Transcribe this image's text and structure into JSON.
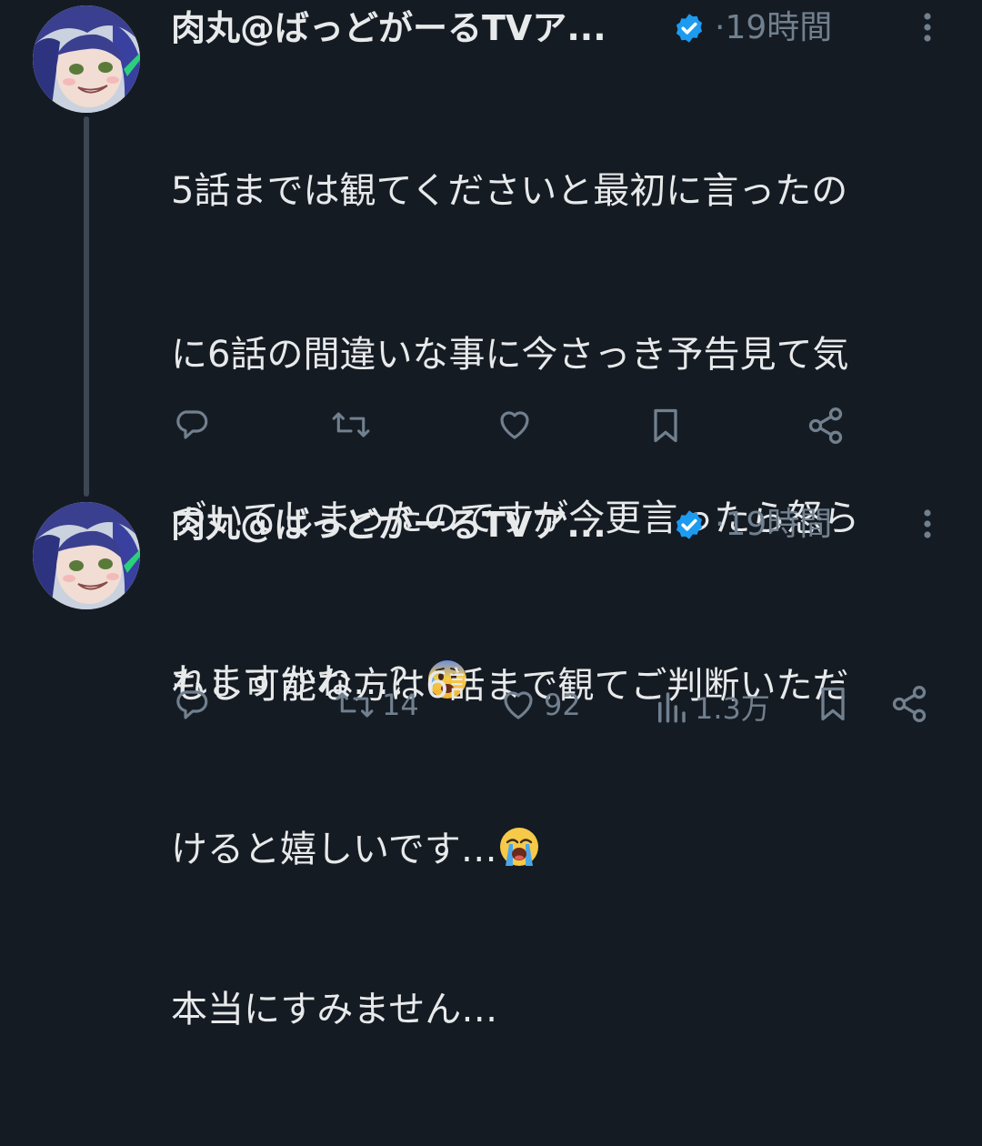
{
  "tweets": [
    {
      "author": "肉丸@ばっどがーるTVア...",
      "time": "·19時間",
      "text_lines": [
        "5話までは観てくださいと最初に言ったの",
        "に6話の間違いな事に今さっき予告見て気",
        "づいてしまったのですが今更言ったら怒ら",
        "れますかね…？",
        "",
        "本当にすみません…"
      ],
      "emoji_after_line4": "anxious-face-with-sweat-emoji"
    },
    {
      "author": "肉丸@ばっどがーるTVア...",
      "time": "·19時間",
      "text_lines": [
        "もし可能な方は6話まで観てご判断いただ",
        "けると嬉しいです…"
      ],
      "emoji_end": "loudly-crying-face-emoji",
      "stats": {
        "retweets": "14",
        "likes": "92",
        "views": "1.3万"
      }
    }
  ],
  "colors": {
    "background": "#151b23",
    "text": "#e7e9ea",
    "muted": "#71808f",
    "verified": "#1d9bf0",
    "thread_line": "#3b4753"
  }
}
